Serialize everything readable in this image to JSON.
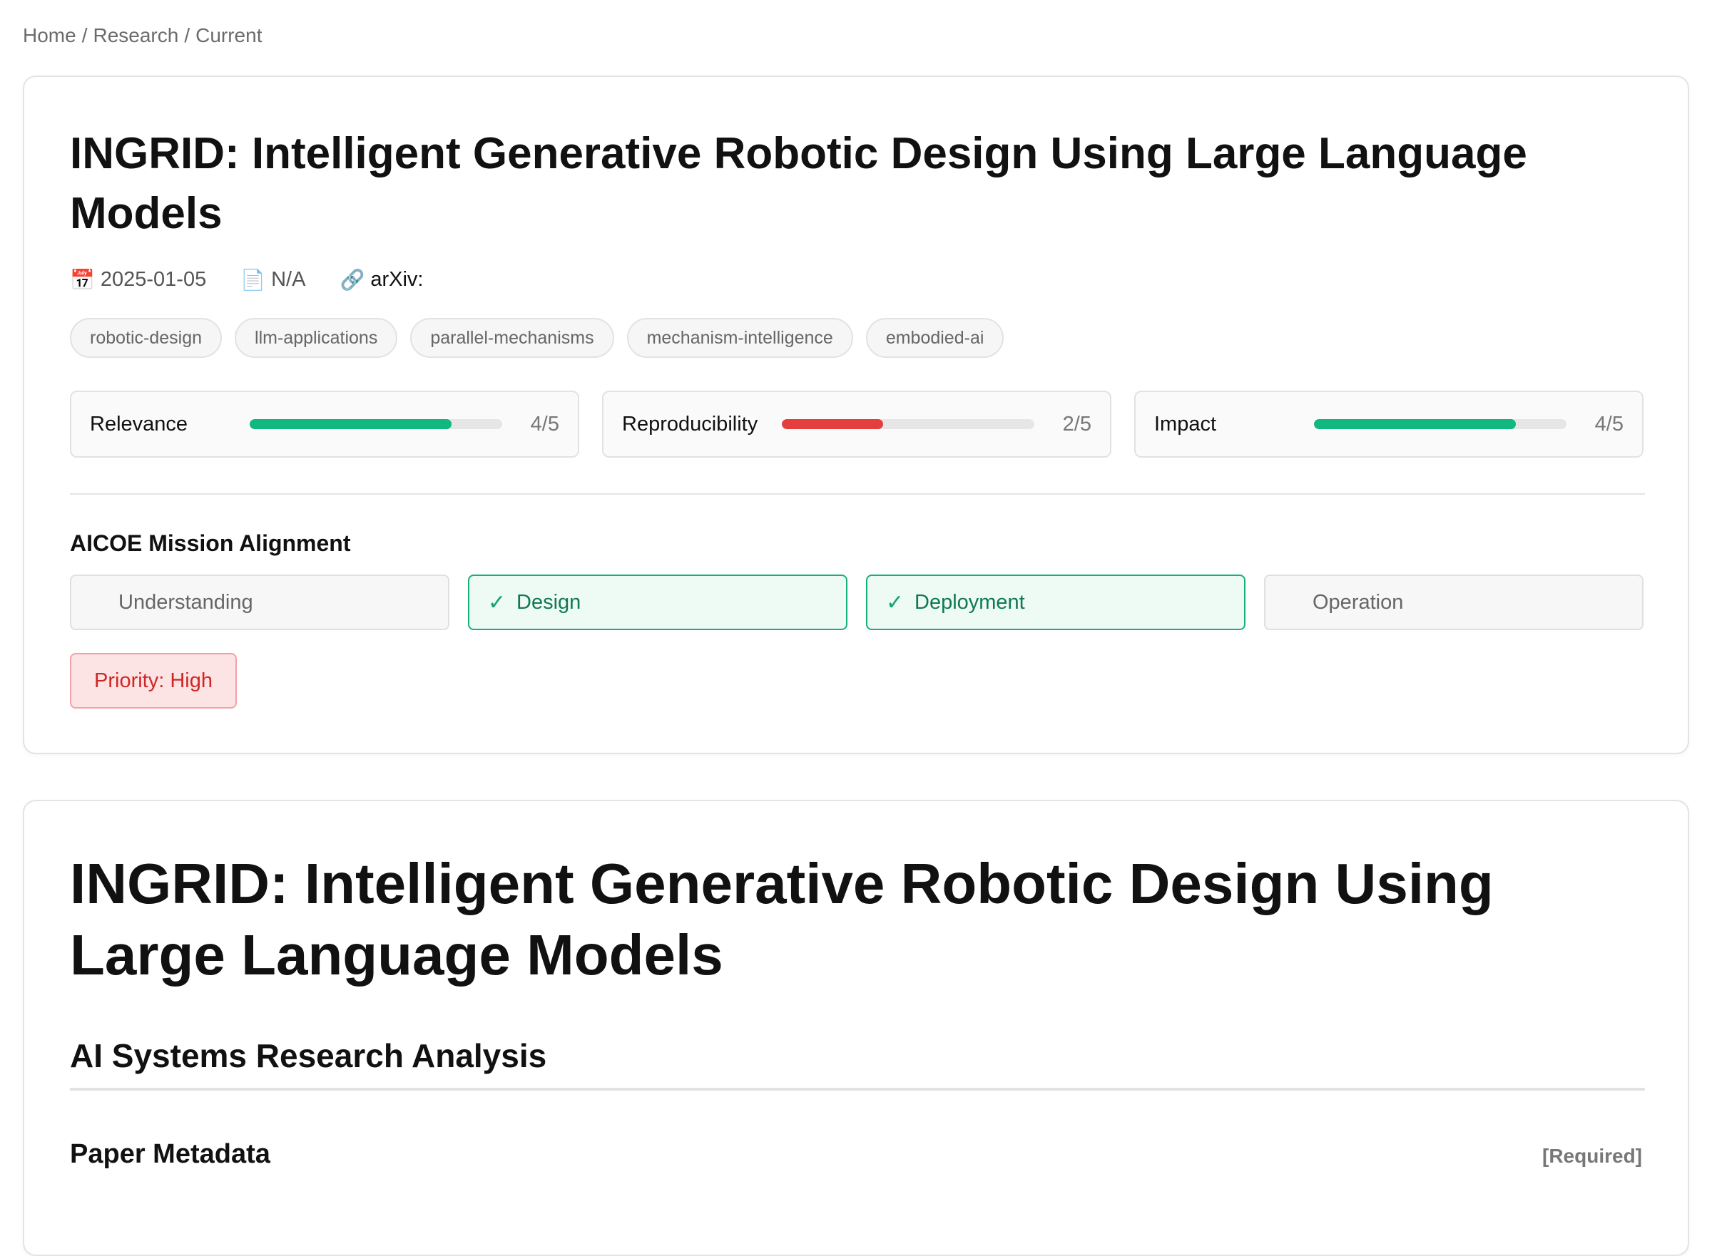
{
  "breadcrumb": {
    "items": [
      "Home",
      "Research",
      "Current"
    ],
    "separator": "/"
  },
  "paper_header": {
    "title": "INGRID: Intelligent Generative Robotic Design Using Large Language Models",
    "meta": {
      "date": "2025-01-05",
      "date_icon": "calendar-icon",
      "pages": "N/A",
      "pages_icon": "document-icon",
      "arxiv": "arXiv:",
      "arxiv_icon": "link-icon"
    },
    "tags": [
      "robotic-design",
      "llm-applications",
      "parallel-mechanisms",
      "mechanism-intelligence",
      "embodied-ai"
    ],
    "scores": [
      {
        "label": "Relevance",
        "value": 4,
        "max": 5,
        "display": "4/5",
        "color": "#10b77f"
      },
      {
        "label": "Reproducibility",
        "value": 2,
        "max": 5,
        "display": "2/5",
        "color": "#e53e3e"
      },
      {
        "label": "Impact",
        "value": 4,
        "max": 5,
        "display": "4/5",
        "color": "#10b77f"
      }
    ],
    "mission": {
      "heading": "AICOE Mission Alignment",
      "items": [
        {
          "label": "Understanding",
          "checked": false
        },
        {
          "label": "Design",
          "checked": true
        },
        {
          "label": "Deployment",
          "checked": true
        },
        {
          "label": "Operation",
          "checked": false
        }
      ],
      "check_glyph": "✓"
    },
    "priority": "Priority: High"
  },
  "analysis": {
    "title": "INGRID: Intelligent Generative Robotic Design Using Large Language Models",
    "section_heading": "AI Systems Research Analysis",
    "subsection_heading": "Paper Metadata",
    "required_badge": "[Required]"
  },
  "colors": {
    "accent_green": "#10b77f",
    "accent_red": "#e53e3e",
    "priority_bg": "#fde4e4",
    "priority_text": "#d02626"
  }
}
